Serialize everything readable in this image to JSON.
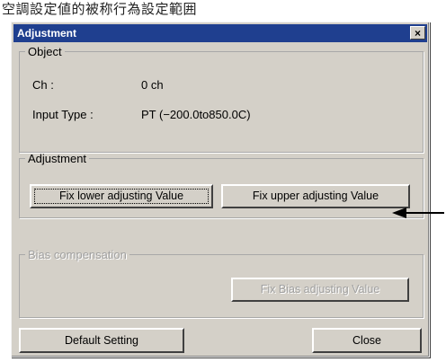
{
  "caption": "空調設定値的被称行為設定範囲",
  "window": {
    "title": "Adjustment",
    "close_label": "×"
  },
  "object": {
    "legend": "Object",
    "ch_label": "Ch :",
    "ch_value": "0 ch",
    "input_type_label": "Input Type :",
    "input_type_value": "PT (−200.0to850.0C)"
  },
  "adjustment": {
    "legend": "Adjustment",
    "fix_lower_label": "Fix lower adjusting Value",
    "fix_upper_label": "Fix upper adjusting Value"
  },
  "bias": {
    "legend": "Bias compensation",
    "fix_bias_label": "Fix Bias adjusting Value"
  },
  "footer": {
    "default_label": "Default Setting",
    "close_label": "Close"
  }
}
